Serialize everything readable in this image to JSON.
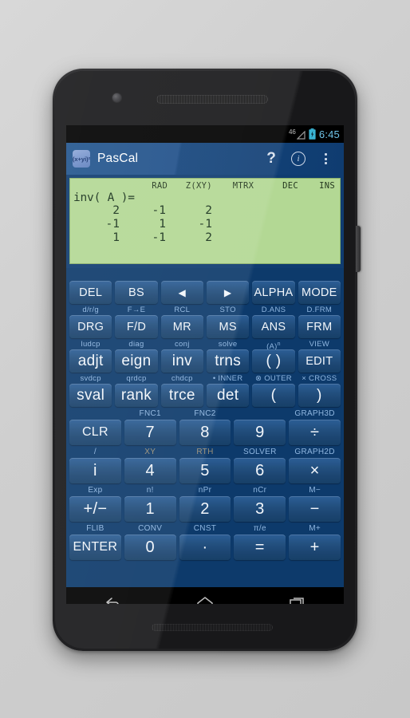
{
  "statusbar": {
    "network": "46",
    "time": "6:45",
    "battery_icon": "battery-charging-icon",
    "signal_icon": "signal-triangle-icon"
  },
  "actionbar": {
    "app_icon_text": "(x+yi)²",
    "title": "PasCal",
    "help_label": "?",
    "info_label": "i",
    "overflow_label": "overflow-menu"
  },
  "display": {
    "status_flags": [
      "RAD",
      "Z(XY)",
      "MTRX",
      "DEC",
      "INS"
    ],
    "expression": "inv( A )=",
    "matrix": [
      [
        "2",
        "-1",
        "2"
      ],
      [
        "-1",
        "1",
        "-1"
      ],
      [
        "1",
        "-1",
        "2"
      ]
    ],
    "bg_color": "#b3d894",
    "text_color": "#16301a"
  },
  "keypad": {
    "accent_color": "#2c5e96",
    "label_color": "#8fb6e0",
    "label_dim_color": "#9a9078",
    "rows": [
      {
        "labels": [
          "",
          "",
          "",
          "",
          "",
          ""
        ],
        "keys": [
          "DEL",
          "BS",
          "◀",
          "▶",
          "ALPHA",
          "MODE"
        ],
        "key_sizes": [
          "sm",
          "sm",
          "tri",
          "tri",
          "sm",
          "sm"
        ]
      },
      {
        "labels": [
          "d/r/g",
          "F→E",
          "RCL",
          "STO",
          "D.ANS",
          "D.FRM"
        ],
        "keys": [
          "DRG",
          "F/D",
          "MR",
          "MS",
          "ANS",
          "FRM"
        ],
        "key_sizes": [
          "sm",
          "sm",
          "sm",
          "sm",
          "sm",
          "sm"
        ]
      },
      {
        "labels": [
          "ludcp",
          "diag",
          "conj",
          "solve",
          "(A)ⁿ",
          "VIEW"
        ],
        "keys": [
          "adjt",
          "eign",
          "inv",
          "trns",
          "( )",
          "EDIT"
        ],
        "key_sizes": [
          "big",
          "big",
          "big",
          "big",
          "big",
          "sm"
        ]
      },
      {
        "labels": [
          "svdcp",
          "qrdcp",
          "chdcp",
          "• INNER",
          "⊗ OUTER",
          "× CROSS"
        ],
        "keys": [
          "sval",
          "rank",
          "trce",
          "det",
          "(",
          ")"
        ],
        "key_sizes": [
          "big",
          "big",
          "big",
          "big",
          "big",
          "big"
        ]
      }
    ],
    "numrows": [
      {
        "labels": [
          "",
          "FNC1",
          "FNC2",
          "",
          "GRAPH3D"
        ],
        "labels_dim": [
          false,
          false,
          false,
          false,
          false
        ],
        "keys": [
          "CLR",
          "7",
          "8",
          "9",
          "÷"
        ],
        "key_sizes": [
          "sm",
          "",
          "",
          "",
          ""
        ]
      },
      {
        "labels": [
          "/",
          "XY",
          "RTH",
          "SOLVER",
          "GRAPH2D"
        ],
        "labels_dim": [
          false,
          true,
          true,
          false,
          false
        ],
        "keys": [
          "i",
          "4",
          "5",
          "6",
          "×"
        ],
        "key_sizes": [
          "",
          "",
          "",
          "",
          ""
        ]
      },
      {
        "labels": [
          "Exp",
          "n!",
          "nPr",
          "nCr",
          "M−"
        ],
        "labels_dim": [
          false,
          false,
          false,
          false,
          false
        ],
        "keys": [
          "+/−",
          "1",
          "2",
          "3",
          "−"
        ],
        "key_sizes": [
          "",
          "",
          "",
          "",
          ""
        ]
      },
      {
        "labels": [
          "FLIB",
          "CONV",
          "CNST",
          "π/e",
          "M+"
        ],
        "labels_dim": [
          false,
          false,
          false,
          false,
          false
        ],
        "keys": [
          "ENTER",
          "0",
          "·",
          "=",
          "+"
        ],
        "key_sizes": [
          "sm",
          "",
          "",
          "",
          ""
        ]
      }
    ]
  },
  "navbar": {
    "back": "back-icon",
    "home": "home-icon",
    "recents": "recents-icon"
  }
}
